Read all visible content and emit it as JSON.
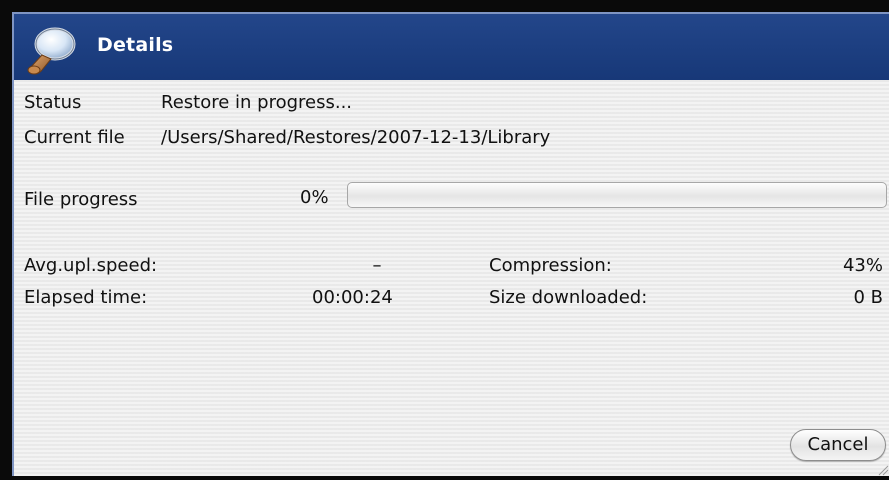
{
  "window": {
    "title": "Details",
    "icon": "magnifier-icon"
  },
  "status": {
    "label": "Status",
    "value": "Restore in progress..."
  },
  "current_file": {
    "label": "Current file",
    "value": "/Users/Shared/Restores/2007-12-13/Library"
  },
  "file_progress": {
    "label": "File progress",
    "percent_text": "0%",
    "fraction": 0
  },
  "stats": {
    "avg_speed_label": "Avg.upl.speed:",
    "avg_speed_value": "–",
    "elapsed_label": "Elapsed time:",
    "elapsed_value": "00:00:24",
    "compression_label": "Compression:",
    "compression_value": "43%",
    "size_label": "Size downloaded:",
    "size_value": "0 B"
  },
  "buttons": {
    "cancel": "Cancel"
  },
  "colors": {
    "titlebar": "#1d3f80",
    "panel": "#ededed"
  }
}
